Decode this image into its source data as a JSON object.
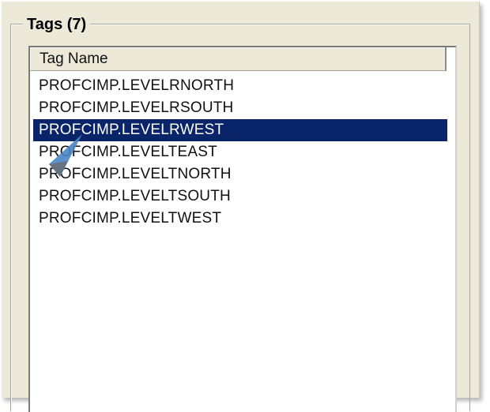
{
  "group": {
    "title": "Tags (7)"
  },
  "list": {
    "column_header": "Tag Name",
    "selected_index": 2,
    "rows": [
      {
        "label": "PROFCIMP.LEVELRNORTH"
      },
      {
        "label": "PROFCIMP.LEVELRSOUTH"
      },
      {
        "label": "PROFCIMP.LEVELRWEST"
      },
      {
        "label": "PROFCIMP.LEVELTEAST"
      },
      {
        "label": "PROFCIMP.LEVELTNORTH"
      },
      {
        "label": "PROFCIMP.LEVELTSOUTH"
      },
      {
        "label": "PROFCIMP.LEVELTWEST"
      }
    ]
  },
  "colors": {
    "selection": "#0a246a",
    "panel": "#ece9d8"
  },
  "icons": {
    "pointer": "mouse-pointer-icon"
  }
}
